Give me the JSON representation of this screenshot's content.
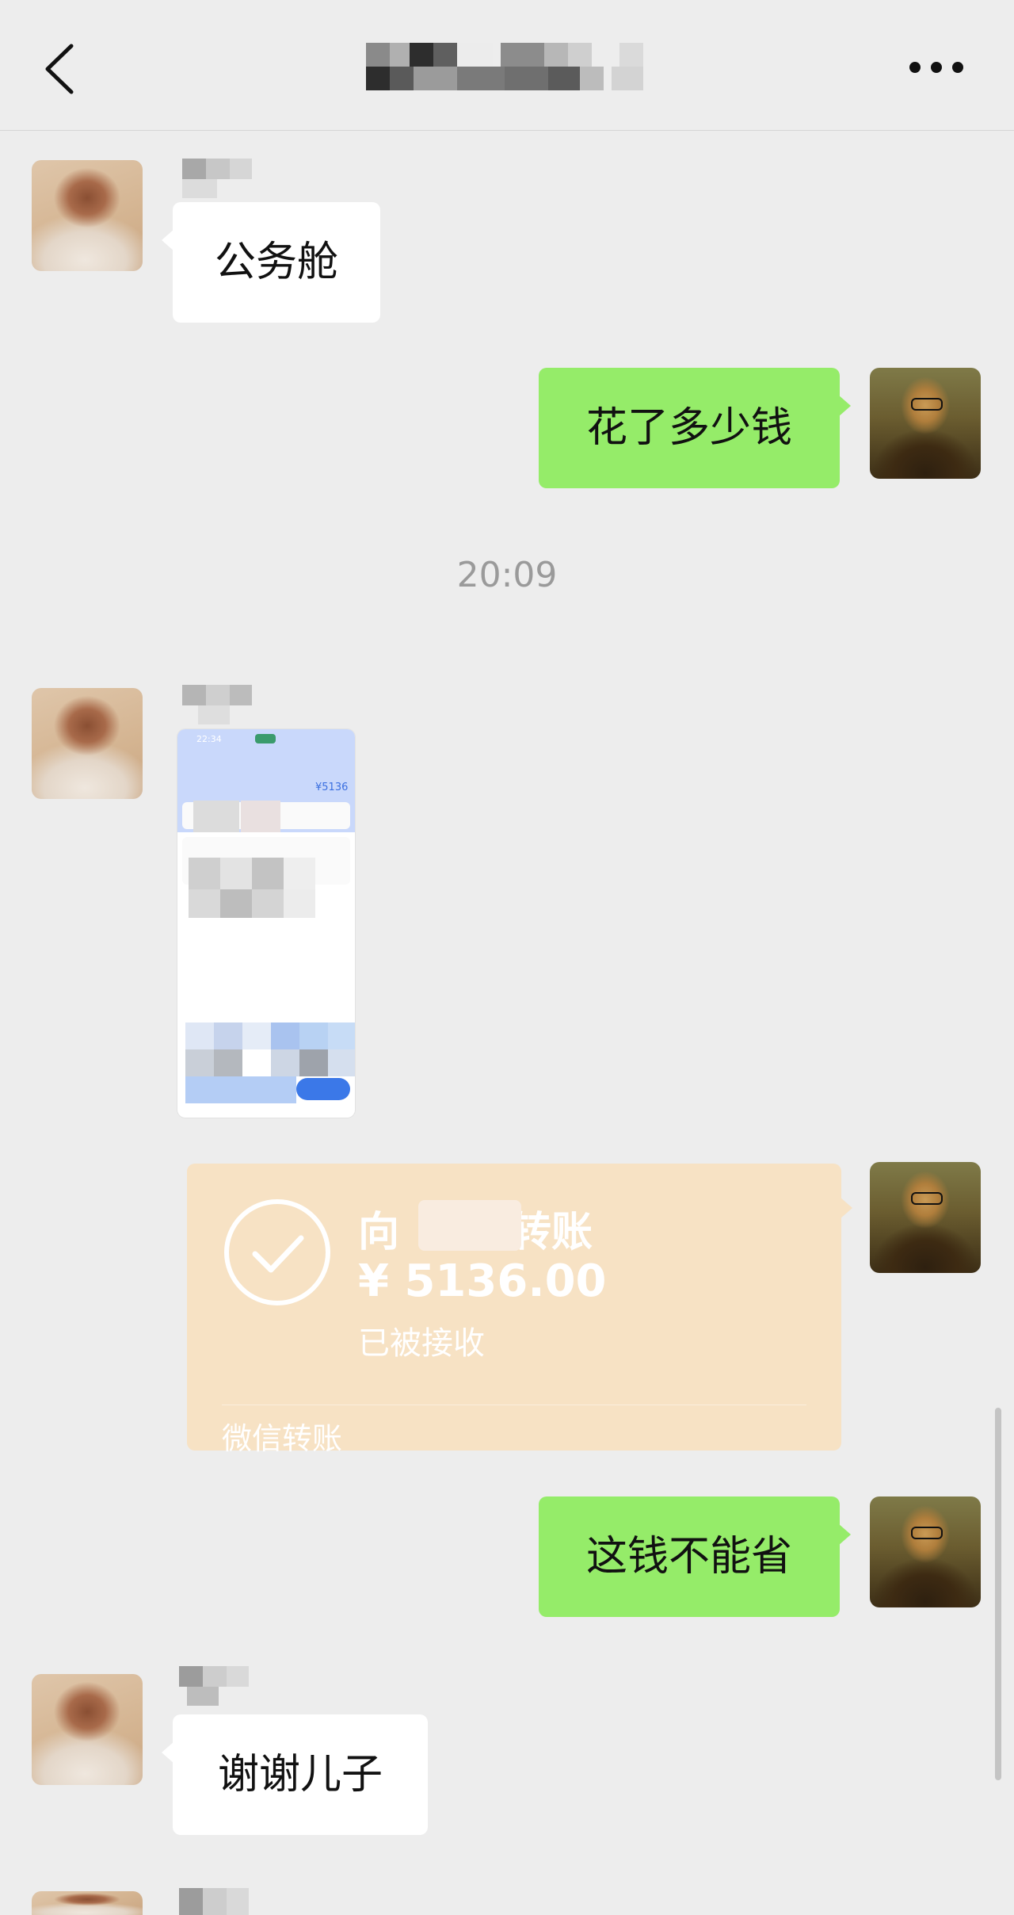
{
  "header": {
    "title": "",
    "back_icon": "chevron-left-icon",
    "more_icon": "more-horizontal-icon"
  },
  "messages": [
    {
      "side": "left",
      "text": "公务舱"
    },
    {
      "side": "right",
      "text": "花了多少钱"
    },
    {
      "type": "timestamp",
      "text": "20:09"
    },
    {
      "side": "left",
      "type": "image",
      "image": {
        "time": "22:34",
        "amount": "¥5136"
      }
    },
    {
      "side": "right",
      "type": "transfer",
      "transfer": {
        "title_prefix": "向",
        "title_suffix": "转账",
        "amount": "¥ 5136.00",
        "status": "已被接收",
        "footer": "微信转账"
      }
    },
    {
      "side": "right",
      "text": "这钱不能省"
    },
    {
      "side": "left",
      "text": "谢谢儿子"
    }
  ],
  "colors": {
    "background": "#ededed",
    "bubble_green": "#95ec69",
    "bubble_white": "#ffffff",
    "transfer_card": "#f7e2c4",
    "timestamp": "#9a9a9a"
  }
}
